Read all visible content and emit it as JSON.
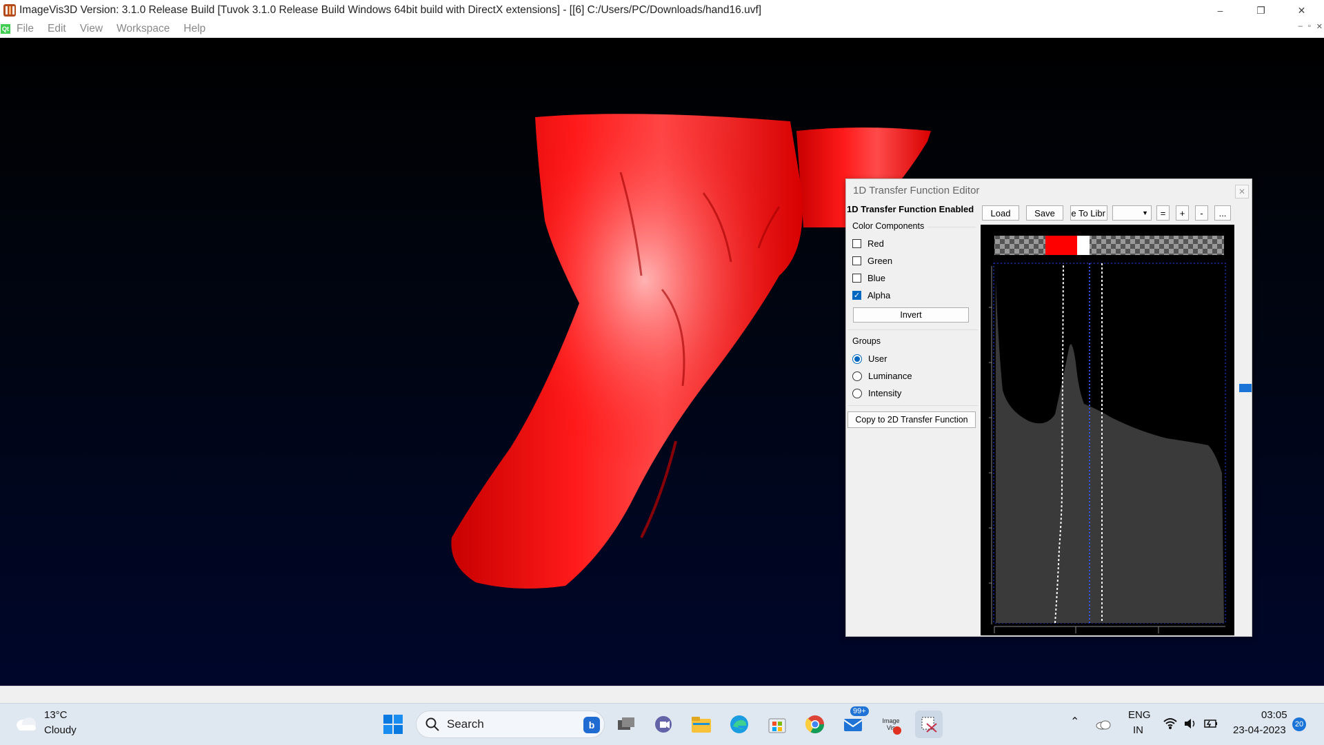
{
  "window": {
    "title": "ImageVis3D Version: 3.1.0 Release Build [Tuvok 3.1.0 Release Build Windows 64bit build with DirectX extensions] - [[6] C:/Users/PC/Downloads/hand16.uvf]",
    "controls": {
      "minimize": "–",
      "restore": "❐",
      "close": "✕"
    }
  },
  "menubar": {
    "logo": "Qt",
    "items": [
      "File",
      "Edit",
      "View",
      "Workspace",
      "Help"
    ],
    "mdi_controls": [
      "–",
      "▫",
      "✕"
    ]
  },
  "tf_editor": {
    "title": "1D Transfer Function Editor",
    "close": "✕",
    "enabled_label": "1D Transfer Function Enabled",
    "toolbar": {
      "load": "Load",
      "save": "Save",
      "save_lib": "e To Libr",
      "dropdown_value": "",
      "equal": "=",
      "plus": "+",
      "minus": "-",
      "more": "..."
    },
    "color_components": {
      "title": "Color Components",
      "items": [
        {
          "label": "Red",
          "checked": false
        },
        {
          "label": "Green",
          "checked": false
        },
        {
          "label": "Blue",
          "checked": false
        },
        {
          "label": "Alpha",
          "checked": true
        }
      ],
      "invert": "Invert"
    },
    "groups": {
      "title": "Groups",
      "items": [
        {
          "label": "User",
          "selected": true
        },
        {
          "label": "Luminance",
          "selected": false
        },
        {
          "label": "Intensity",
          "selected": false
        }
      ]
    },
    "copy_button": "Copy to 2D Transfer Function",
    "colors": {
      "transfer_color": "#ff0000",
      "histogram": "#3a3a3a",
      "curve": "#ffffff",
      "marker": "#2255ff"
    }
  },
  "taskbar": {
    "weather": {
      "temp": "13°C",
      "condition": "Cloudy"
    },
    "search_placeholder": "Search",
    "mail_badge": "99+",
    "imagevis_label": "Image\nVis",
    "language": {
      "lang": "ENG",
      "region": "IN"
    },
    "time": "03:05",
    "date": "23-04-2023",
    "notification_count": "20",
    "icons": [
      "windows-start-icon",
      "search-icon",
      "bing-icon",
      "task-view-icon",
      "teams-icon",
      "file-explorer-icon",
      "edge-icon",
      "store-icon",
      "chrome-icon",
      "mail-icon",
      "imagevis3d-icon",
      "snipping-tool-icon",
      "chevron-up-icon",
      "onedrive-icon",
      "wifi-icon",
      "volume-icon",
      "battery-icon"
    ]
  }
}
